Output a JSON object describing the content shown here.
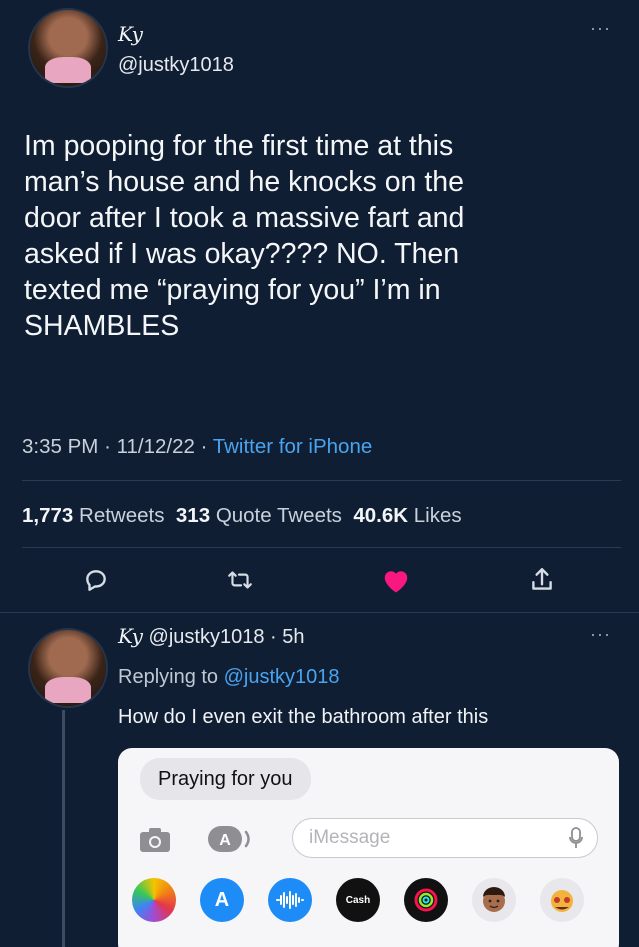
{
  "tweet": {
    "display_name": "Ky",
    "handle": "@justky1018",
    "more_icon": "more-dots-icon",
    "text_lines": [
      "Im pooping for the first time at this",
      "man’s house and he knocks on the",
      "door after I took a massive fart and",
      "asked if I was okay???? NO. Then",
      "texted me “praying for you” I’m in",
      "SHAMBLES"
    ],
    "time": "3:35 PM",
    "date": "11/12/22",
    "client": "Twitter for iPhone",
    "separator": "·",
    "retweets_count": "1,773",
    "retweets_label": "Retweets",
    "quotes_count": "313",
    "quotes_label": "Quote Tweets",
    "likes_count": "40.6K",
    "likes_label": "Likes"
  },
  "actions": {
    "reply_icon": "reply-icon",
    "retweet_icon": "retweet-icon",
    "like_icon": "heart-icon",
    "share_icon": "share-icon",
    "like_color": "#f91880"
  },
  "reply": {
    "display_name": "Ky",
    "handle": "@justky1018",
    "age": "5h",
    "separator": "·",
    "replying_prefix": "Replying to",
    "replying_to": "@justky1018",
    "text": "How do I even exit the bathroom after this",
    "imessage": {
      "bubble_text": "Praying for you",
      "placeholder": "iMessage",
      "apps": [
        "photos-icon",
        "app-store-icon",
        "audio-icon",
        "cash-icon",
        "fitness-icon",
        "memoji-icon",
        "memoji-2-icon"
      ],
      "cash_label": "Cash"
    }
  },
  "colors": {
    "background": "#0f1e33",
    "link": "#4aa3ee"
  }
}
